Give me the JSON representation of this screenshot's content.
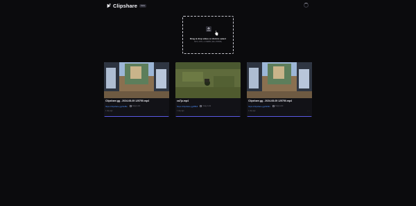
{
  "app": {
    "name": "Clipshare",
    "badge": "beta"
  },
  "upload": {
    "title": "Drag & drop video or click to select",
    "subtitle": "MP4, MOV, or WEBM (Max 250MB)"
  },
  "videos": [
    {
      "title": "Clipshare.gg - 2024-08-05 125750.mp4",
      "link": "https://clipshare.gg/4wf8e",
      "copy_label": "Copy Link",
      "age": "1 day ago",
      "more": "···"
    },
    {
      "title": "ca7ju.mp4",
      "link": "https://clipshare.gg/88kfr",
      "copy_label": "Copy Link",
      "age": "1 day ago",
      "more": "···"
    },
    {
      "title": "Clipshare.gg - 2024-08-05 125750.mp4",
      "link": "https://clipshare.gg/2k9fm",
      "copy_label": "Copy Link",
      "age": "1 day ago",
      "more": "···"
    }
  ],
  "colors": {
    "background": "#0b0b0d",
    "card": "#121217",
    "link": "#4d8bf5",
    "accent": "#5a5ae6"
  }
}
